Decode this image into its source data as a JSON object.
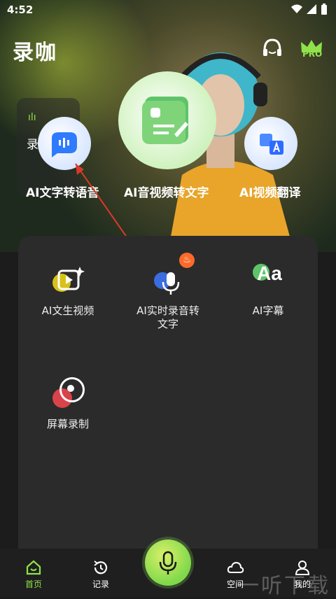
{
  "status": {
    "time": "4:52"
  },
  "header": {
    "title": "录咖",
    "pro_badge": "PRO"
  },
  "features": {
    "left_card_label": "录",
    "text_to_speech": "AI文字转语音",
    "av_to_text": "AI音视频转文字",
    "video_translate": "AI视频翻译"
  },
  "tools": [
    {
      "label": "AI文生视频"
    },
    {
      "label": "AI实时录音转文字"
    },
    {
      "label": "AI字幕"
    },
    {
      "label": "屏幕录制"
    }
  ],
  "tabs": {
    "home": "首页",
    "records": "记录",
    "space": "空间",
    "mine": "我的"
  },
  "watermark": "一听下载",
  "colors": {
    "accent": "#8fe24a",
    "panel": "#2b2b2b",
    "tabbar": "#1f1f1f"
  }
}
